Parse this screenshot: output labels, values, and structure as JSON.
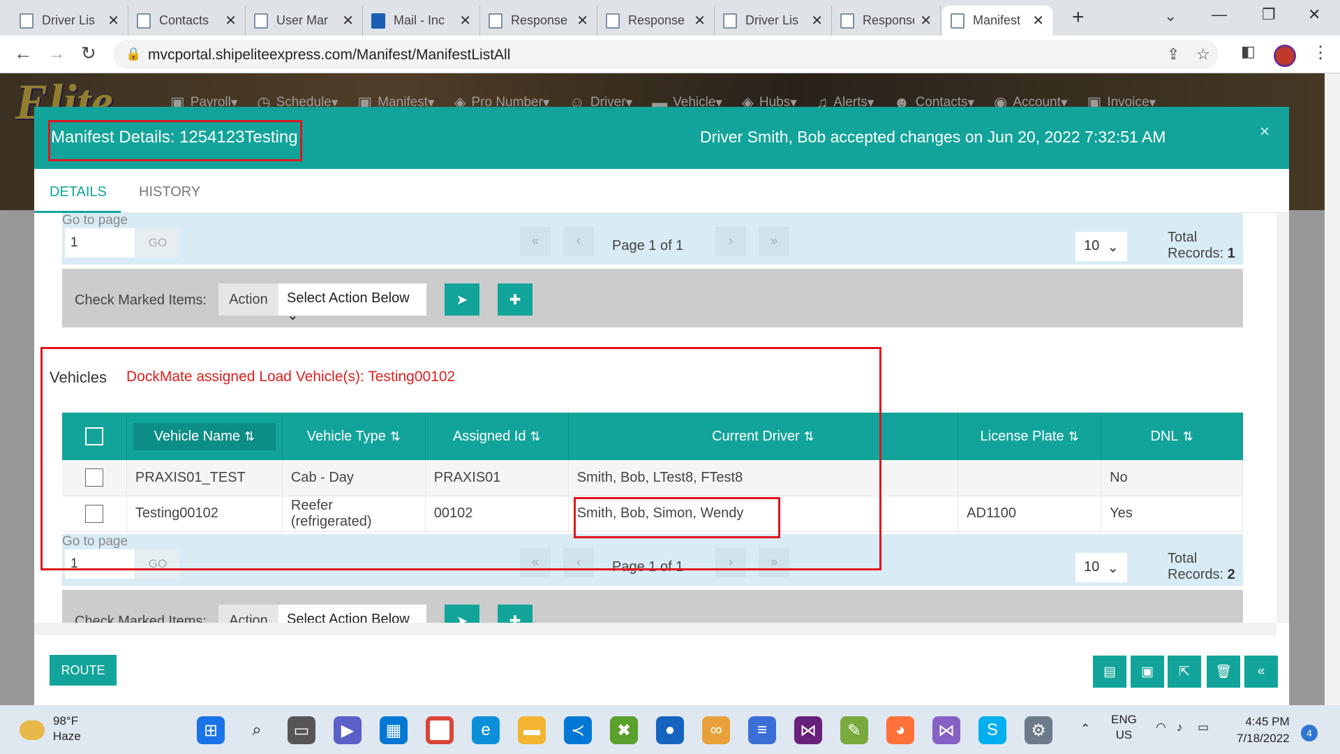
{
  "browser": {
    "tabs": [
      {
        "label": "Driver Lis"
      },
      {
        "label": "Contacts"
      },
      {
        "label": "User Mar"
      },
      {
        "label": "Mail - Inc"
      },
      {
        "label": "Response"
      },
      {
        "label": "Response"
      },
      {
        "label": "Driver Lis"
      },
      {
        "label": "Response"
      },
      {
        "label": "Manifest"
      }
    ],
    "url": "mvcportal.shipeliteexpress.com/Manifest/ManifestListAll"
  },
  "site": {
    "logo_text": "Elite",
    "nav": [
      {
        "label": "Payroll",
        "icon": "clipboard-icon"
      },
      {
        "label": "Schedule",
        "icon": "clock-icon"
      },
      {
        "label": "Manifest",
        "icon": "clipboard-icon"
      },
      {
        "label": "Pro Number",
        "icon": "box-icon"
      },
      {
        "label": "Driver",
        "icon": "user-icon"
      },
      {
        "label": "Vehicle",
        "icon": "truck-icon"
      },
      {
        "label": "Hubs",
        "icon": "box-icon"
      },
      {
        "label": "Alerts",
        "icon": "bell-icon"
      },
      {
        "label": "Contacts",
        "icon": "users-icon"
      },
      {
        "label": "Account",
        "icon": "user-circle-icon"
      },
      {
        "label": "Invoice",
        "icon": "clipboard-icon"
      }
    ]
  },
  "modal": {
    "title": "Manifest Details: 1254123Testing",
    "status": "Driver Smith, Bob accepted changes on Jun 20, 2022 7:32:51 AM",
    "close_label": "×",
    "tabs": {
      "details": "DETAILS",
      "history": "HISTORY"
    },
    "top_pager": {
      "goto_label": "Go to page",
      "page_value": "1",
      "go_label": "GO",
      "page_text": "Page 1 of 1",
      "page_size": "10",
      "total_label": "Total Records:",
      "total_value": "1"
    },
    "action_bar": {
      "label": "Check Marked Items:",
      "action_label": "Action",
      "select_value": "Select Action Below"
    },
    "vehicles": {
      "title": "Vehicles",
      "note": "DockMate assigned Load Vehicle(s): Testing00102",
      "columns": [
        "Vehicle Name",
        "Vehicle Type",
        "Assigned Id",
        "Current Driver",
        "License Plate",
        "DNL"
      ],
      "rows": [
        {
          "name": "PRAXIS01_TEST",
          "type": "Cab - Day",
          "assigned_id": "PRAXIS01",
          "driver": "Smith, Bob, LTest8, FTest8",
          "plate": "",
          "dnl": "No"
        },
        {
          "name": "Testing00102",
          "type": "Reefer (refrigerated)",
          "assigned_id": "00102",
          "driver": "Smith, Bob, Simon, Wendy",
          "plate": "AD1100",
          "dnl": "Yes"
        }
      ]
    },
    "bottom_pager": {
      "goto_label": "Go to page",
      "page_value": "1",
      "go_label": "GO",
      "page_text": "Page 1 of 1",
      "page_size": "10",
      "total_label": "Total Records:",
      "total_value": "2"
    },
    "bottom_action_bar": {
      "label": "Check Marked Items:",
      "action_label": "Action",
      "select_value": "Select Action Below"
    },
    "route_label": "ROUTE"
  },
  "taskbar": {
    "temp": "98°F",
    "condition": "Haze",
    "lang1": "ENG",
    "lang2": "US",
    "time": "4:45 PM",
    "date": "7/18/2022",
    "notifications": "4"
  },
  "colors": {
    "accent": "#12a49a",
    "highlight": "#e0141e"
  }
}
